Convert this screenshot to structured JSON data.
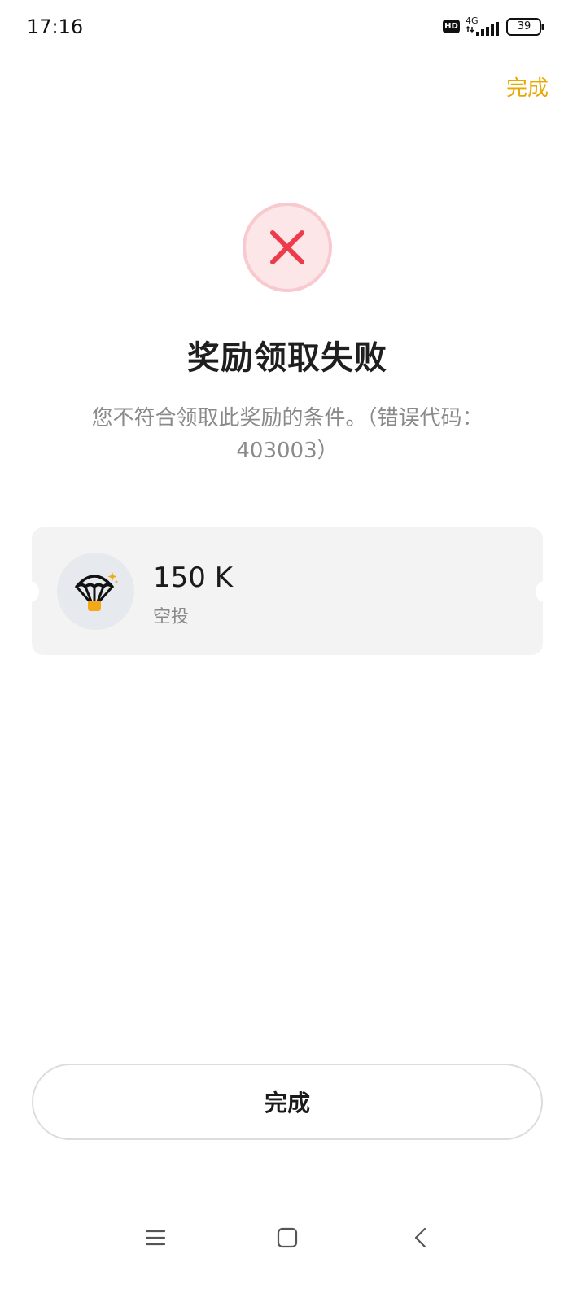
{
  "status_bar": {
    "time": "17:16",
    "hd_badge": "HD",
    "network": "4G",
    "battery": "39"
  },
  "header": {
    "done_label": "完成",
    "accent_color": "#e9a800"
  },
  "result": {
    "icon": "error-x-icon",
    "title": "奖励领取失败",
    "message": "您不符合领取此奖励的条件。（错误代码：403003）",
    "error_color": "#ee3b4b"
  },
  "reward": {
    "icon": "parachute-airdrop-icon",
    "amount": "150 K",
    "type": "空投"
  },
  "footer": {
    "done_button_label": "完成"
  },
  "nav_bar": {
    "items": [
      "menu-icon",
      "home-square-icon",
      "back-chevron-icon"
    ]
  }
}
